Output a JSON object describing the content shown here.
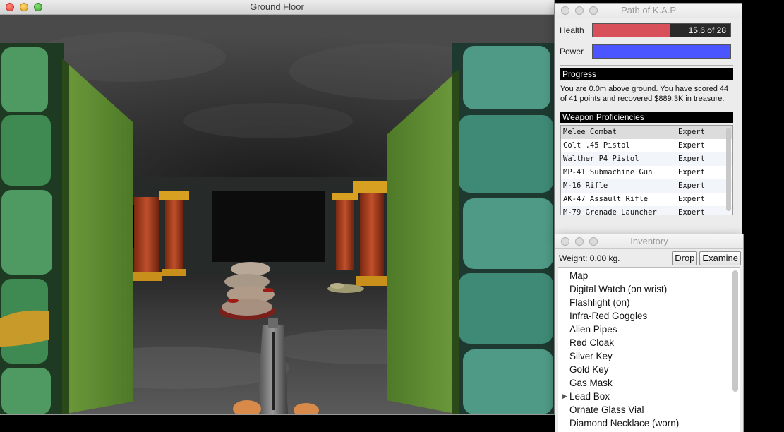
{
  "game_window": {
    "title": "Ground Floor"
  },
  "stats_window": {
    "title": "Path of K.A.P",
    "health": {
      "label": "Health",
      "text": "15.6 of 28",
      "current": 15.6,
      "max": 28,
      "color": "#d7505a"
    },
    "power": {
      "label": "Power",
      "fraction": 1.0,
      "color": "#4a55ff"
    },
    "progress": {
      "heading": "Progress",
      "text": "You are 0.0m above ground.  You have scored 44 of 41 points and recovered $889.3K in treasure."
    },
    "proficiencies": {
      "heading": "Weapon Proficiencies",
      "rows": [
        {
          "weapon": "Melee Combat",
          "level": "Expert"
        },
        {
          "weapon": "Colt .45 Pistol",
          "level": "Expert"
        },
        {
          "weapon": "Walther P4 Pistol",
          "level": "Expert"
        },
        {
          "weapon": "MP-41 Submachine Gun",
          "level": "Expert"
        },
        {
          "weapon": "M-16 Rifle",
          "level": "Expert"
        },
        {
          "weapon": "AK-47 Assault Rifle",
          "level": "Expert"
        },
        {
          "weapon": "M-79 Grenade Launcher",
          "level": "Expert"
        }
      ]
    }
  },
  "inventory_window": {
    "title": "Inventory",
    "weight": "Weight: 0.00 kg.",
    "drop_label": "Drop",
    "examine_label": "Examine",
    "items": [
      "Map",
      "Digital Watch (on wrist)",
      "Flashlight (on)",
      "Infra-Red Goggles",
      "Alien Pipes",
      "Red Cloak",
      "Silver Key",
      "Gold Key",
      "Gas Mask",
      "Lead Box",
      "Ornate Glass Vial",
      "Diamond Necklace (worn)"
    ],
    "expandable_item": "Lead Box"
  }
}
